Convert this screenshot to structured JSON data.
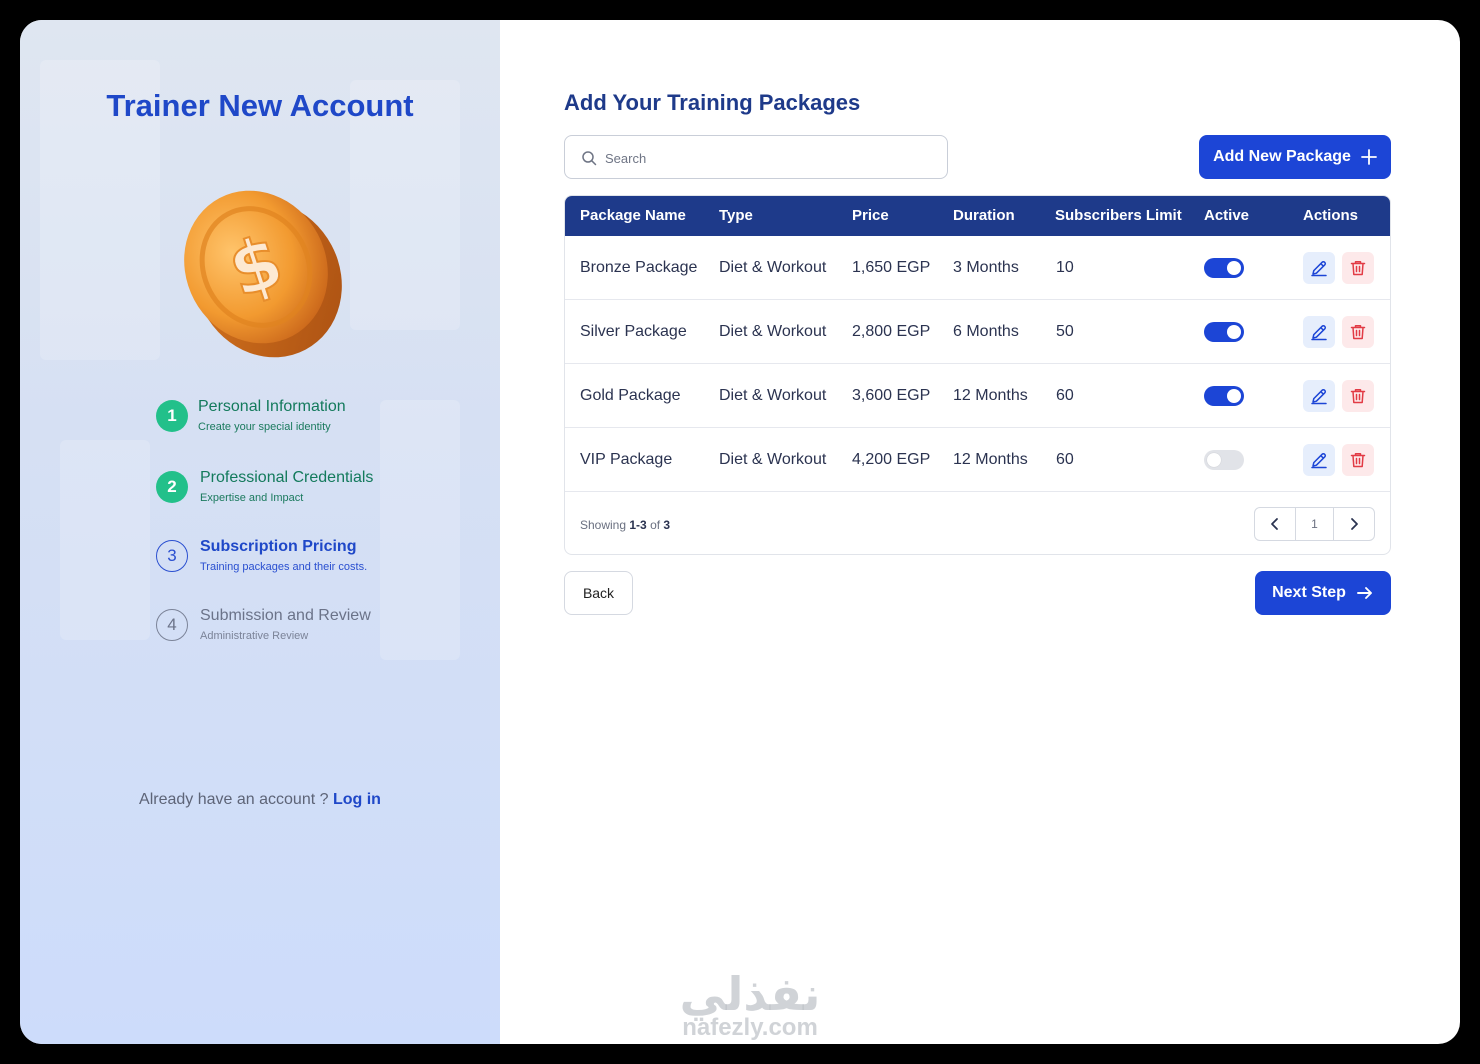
{
  "left": {
    "title": "Trainer New Account",
    "steps": [
      {
        "number": "1",
        "title": "Personal Information",
        "subtitle": "Create your special identity"
      },
      {
        "number": "2",
        "title": "Professional Credentials",
        "subtitle": "Expertise and Impact"
      },
      {
        "number": "3",
        "title": "Subscription Pricing",
        "subtitle": "Training packages and their costs."
      },
      {
        "number": "4",
        "title": "Submission and Review",
        "subtitle": "Administrative Review"
      }
    ],
    "account_prompt": "Already have an account ?",
    "login_label": "Log in"
  },
  "main": {
    "title": "Add Your Training Packages",
    "search_placeholder": "Search",
    "add_button": "Add New Package",
    "columns": [
      "Package Name",
      "Type",
      "Price",
      "Duration",
      "Subscribers Limit",
      "Active",
      "Actions"
    ],
    "rows": [
      {
        "name": "Bronze Package",
        "type": "Diet & Workout",
        "price": "1,650 EGP",
        "duration": "3 Months",
        "limit": "10",
        "active": true
      },
      {
        "name": "Silver Package",
        "type": "Diet & Workout",
        "price": "2,800 EGP",
        "duration": "6 Months",
        "limit": "50",
        "active": true
      },
      {
        "name": "Gold Package",
        "type": "Diet & Workout",
        "price": "3,600 EGP",
        "duration": "12 Months",
        "limit": "60",
        "active": true
      },
      {
        "name": "VIP Package",
        "type": "Diet & Workout",
        "price": "4,200 EGP",
        "duration": "12 Months",
        "limit": "60",
        "active": false
      }
    ],
    "showing_prefix": "Showing",
    "showing_range": "1-3",
    "showing_of": "of",
    "showing_total": "3",
    "current_page": "1",
    "back_button": "Back",
    "next_button": "Next Step"
  },
  "watermark": {
    "arabic": "نفذلي",
    "latin": "nafezly.com"
  },
  "colors": {
    "primary": "#1c45d6",
    "header": "#1e3a8a",
    "done": "#22c08a",
    "danger": "#e23b45"
  }
}
